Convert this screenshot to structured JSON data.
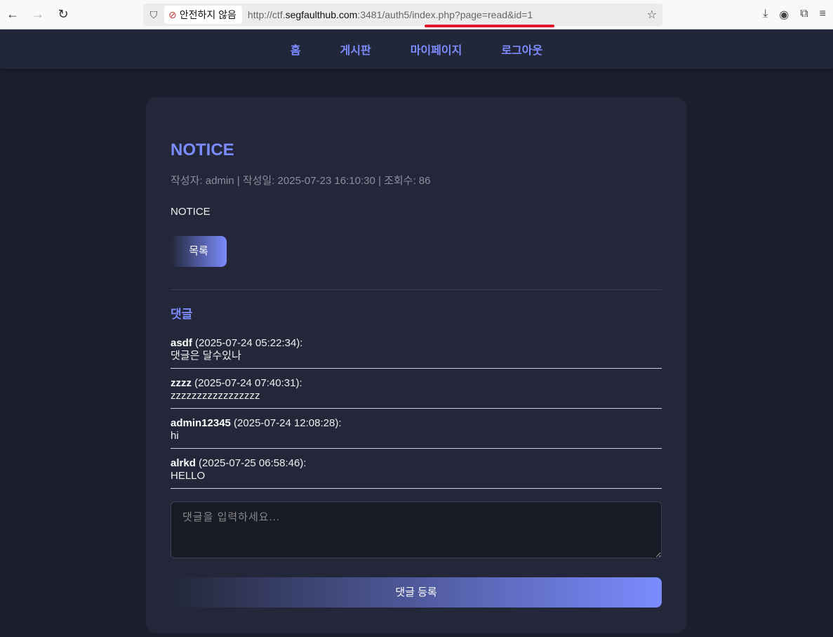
{
  "browser": {
    "security_label": "안전하지 않음",
    "url_prefix": "http://ctf.",
    "url_domain": "segfaulthub.com",
    "url_rest": ":3481/auth5/index.php?page=read&id=1"
  },
  "nav": [
    "홈",
    "게시판",
    "마이페이지",
    "로그아웃"
  ],
  "post": {
    "title": "NOTICE",
    "meta": "작성자: admin | 작성일: 2025-07-23 16:10:30 | 조회수: 86",
    "content": "NOTICE",
    "list_button": "목록"
  },
  "comments": {
    "heading": "댓글",
    "items": [
      {
        "author": "asdf",
        "time": " (2025-07-24 05:22:34):",
        "text": "댓글은 달수있나"
      },
      {
        "author": "zzzz",
        "time": " (2025-07-24 07:40:31):",
        "text": "zzzzzzzzzzzzzzzzz"
      },
      {
        "author": "admin12345",
        "time": " (2025-07-24 12:08:28):",
        "text": "hi"
      },
      {
        "author": "alrkd",
        "time": " (2025-07-25 06:58:46):",
        "text": "HELLO"
      }
    ],
    "placeholder": "댓글을 입력하세요...",
    "submit": "댓글 등록"
  }
}
